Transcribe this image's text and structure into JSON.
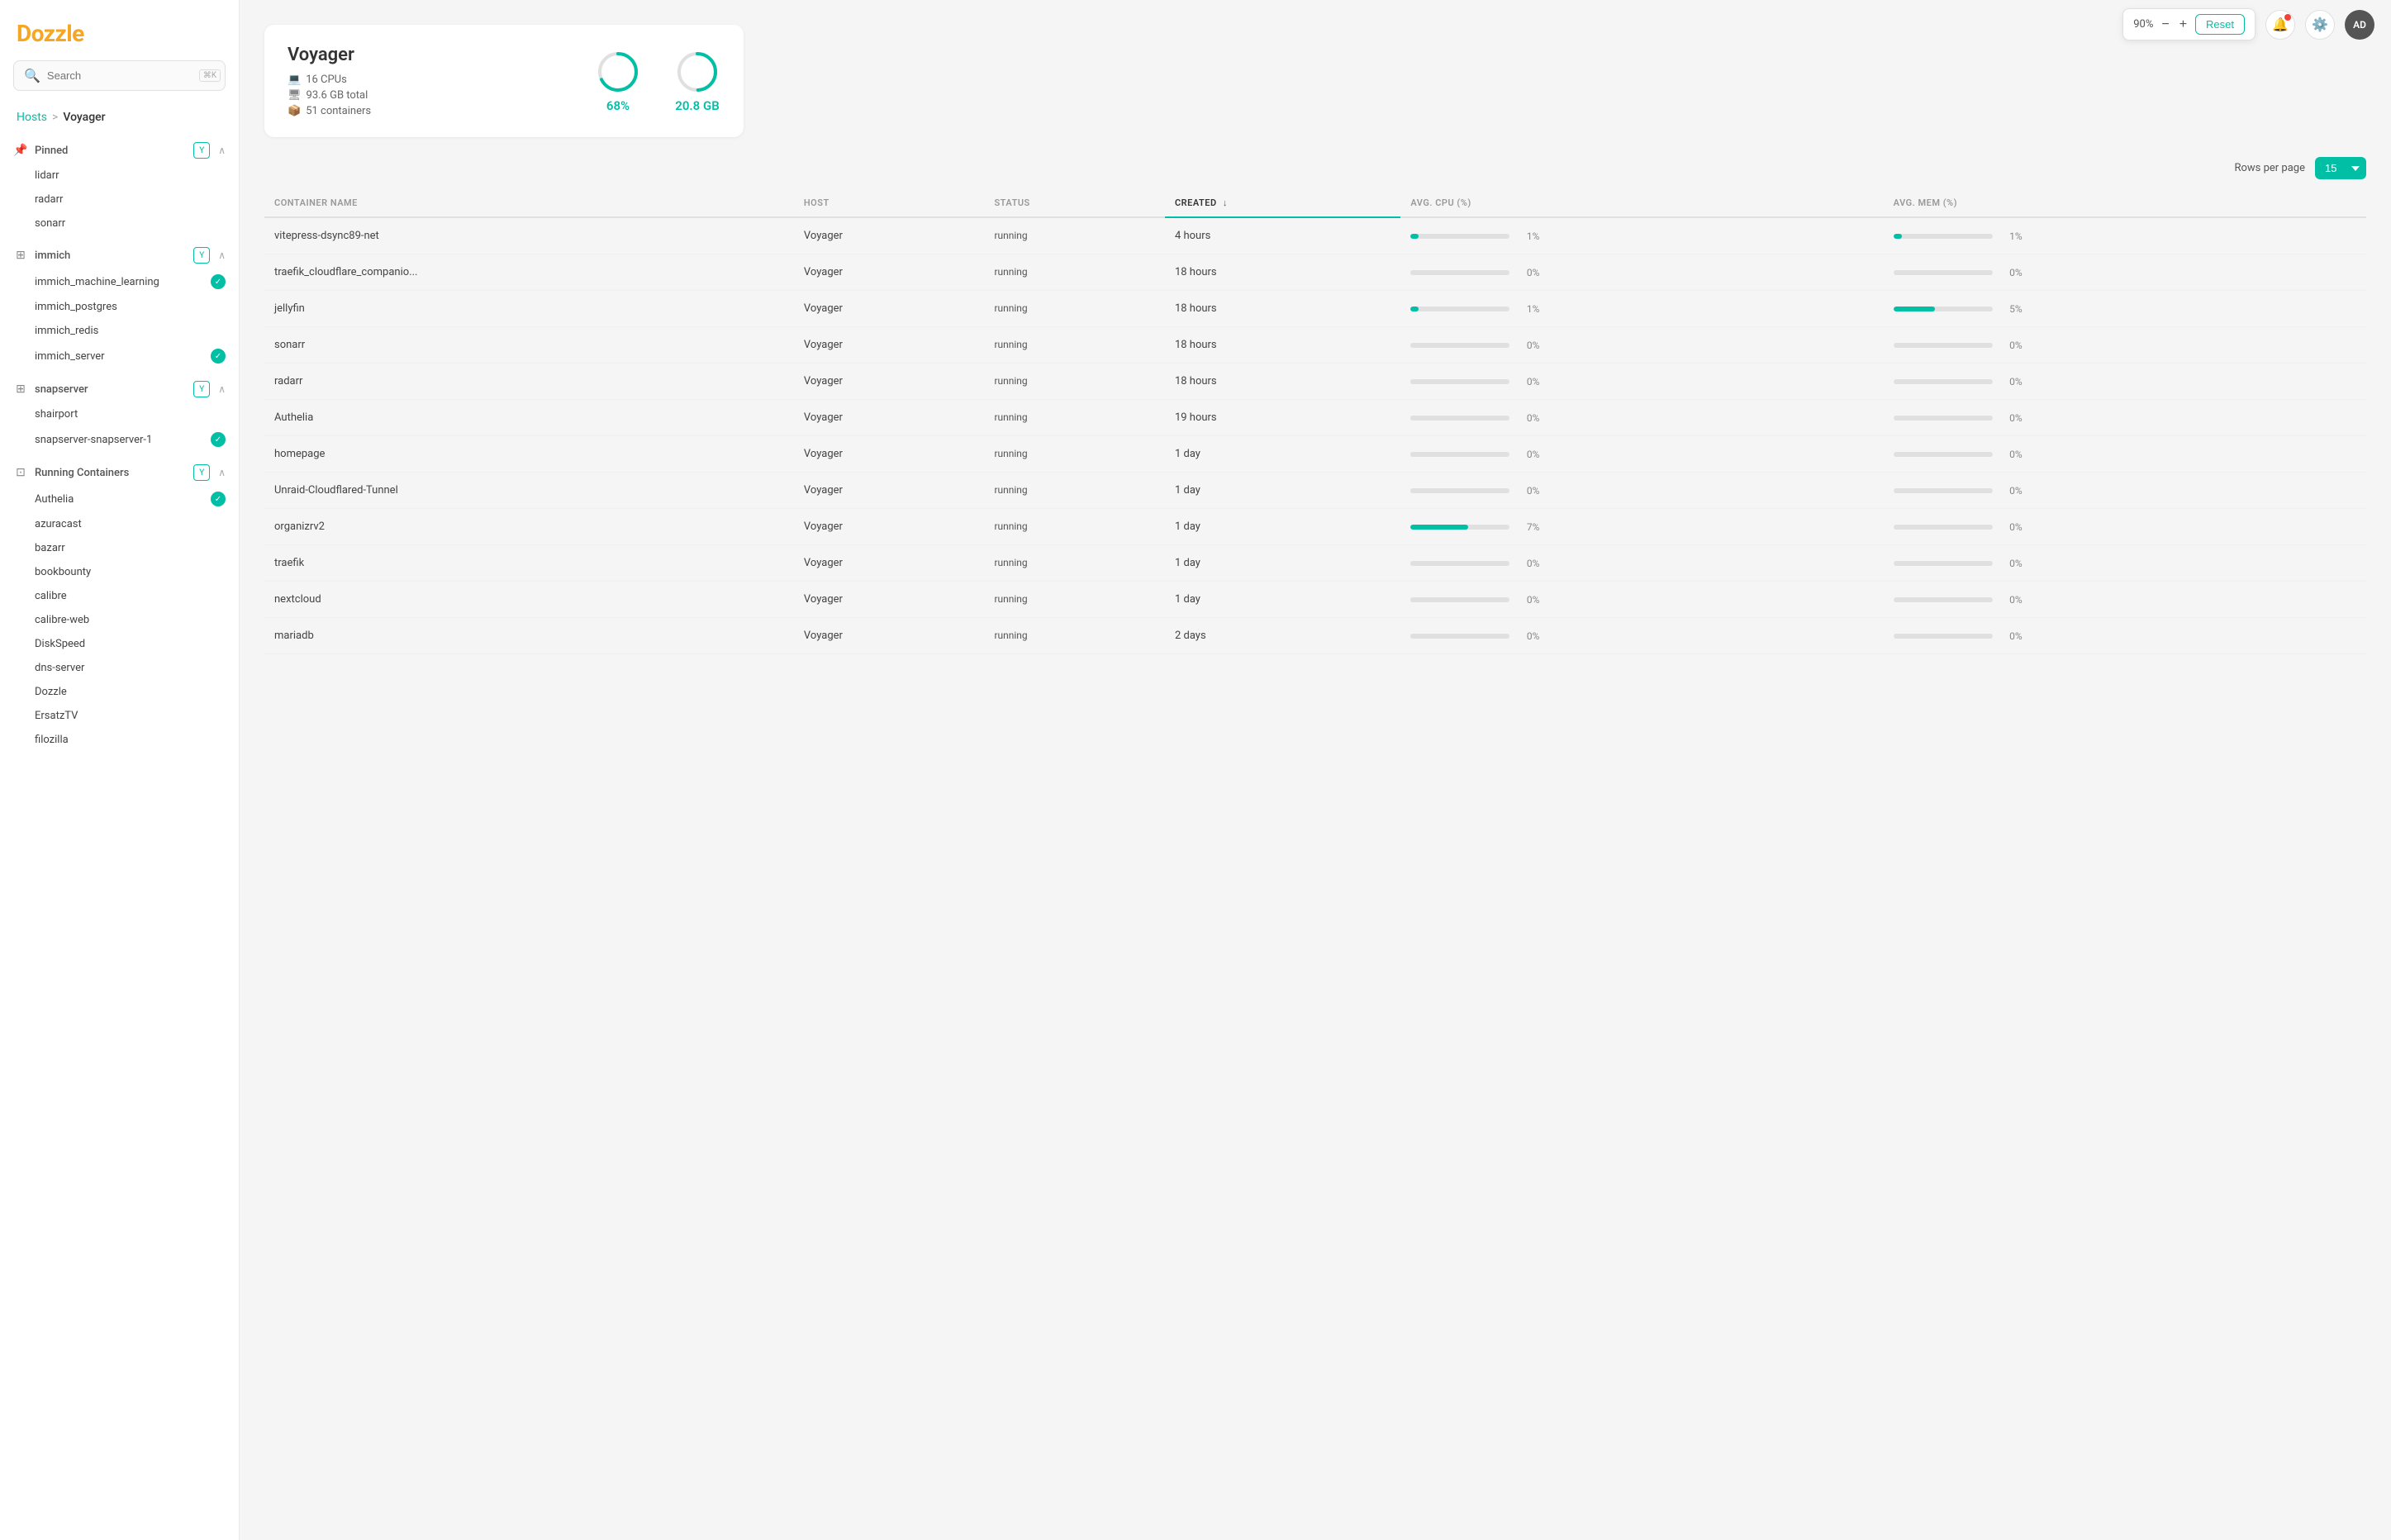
{
  "app": {
    "name": "Dozzle"
  },
  "topbar": {
    "zoom": "90%",
    "minus_label": "−",
    "plus_label": "+",
    "reset_label": "Reset",
    "avatar_label": "AD"
  },
  "sidebar": {
    "search_placeholder": "Search",
    "search_shortcut": "⌘K",
    "breadcrumb": {
      "hosts": "Hosts",
      "separator": ">",
      "current": "Voyager"
    },
    "pinned_section": {
      "label": "Pinned",
      "items": [
        {
          "label": "lidarr",
          "check": false
        },
        {
          "label": "radarr",
          "check": false
        },
        {
          "label": "sonarr",
          "check": false
        }
      ]
    },
    "immich_section": {
      "label": "immich",
      "items": [
        {
          "label": "immich_machine_learning",
          "check": true
        },
        {
          "label": "immich_postgres",
          "check": false
        },
        {
          "label": "immich_redis",
          "check": false
        },
        {
          "label": "immich_server",
          "check": true
        }
      ]
    },
    "snapserver_section": {
      "label": "snapserver",
      "items": [
        {
          "label": "shairport",
          "check": false
        },
        {
          "label": "snapserver-snapserver-1",
          "check": true
        }
      ]
    },
    "running_section": {
      "label": "Running Containers",
      "items": [
        {
          "label": "Authelia",
          "check": true
        },
        {
          "label": "azuracast",
          "check": false
        },
        {
          "label": "bazarr",
          "check": false
        },
        {
          "label": "bookbounty",
          "check": false
        },
        {
          "label": "calibre",
          "check": false
        },
        {
          "label": "calibre-web",
          "check": false
        },
        {
          "label": "DiskSpeed",
          "check": false
        },
        {
          "label": "dns-server",
          "check": false
        },
        {
          "label": "Dozzle",
          "check": false
        },
        {
          "label": "ErsatzTV",
          "check": false
        },
        {
          "label": "filozilla",
          "check": false
        }
      ]
    }
  },
  "host_card": {
    "name": "Voyager",
    "cpus": "16 CPUs",
    "memory": "93.6 GB total",
    "containers": "51 containers",
    "cpu_percent": "68%",
    "mem_value": "20.8 GB"
  },
  "table": {
    "rows_per_page_label": "Rows per page",
    "rows_per_page_value": "15",
    "columns": [
      "CONTAINER NAME",
      "HOST",
      "STATUS",
      "CREATED",
      "AVG. CPU (%)",
      "AVG. MEM (%)"
    ],
    "rows": [
      {
        "name": "vitepress-dsync89-net",
        "host": "Voyager",
        "status": "running",
        "created": "4 hours",
        "cpu": 1,
        "cpu_label": "1%",
        "mem": 1,
        "mem_label": "1%"
      },
      {
        "name": "traefik_cloudflare_companio...",
        "host": "Voyager",
        "status": "running",
        "created": "18 hours",
        "cpu": 0,
        "cpu_label": "0%",
        "mem": 0,
        "mem_label": "0%"
      },
      {
        "name": "jellyfin",
        "host": "Voyager",
        "status": "running",
        "created": "18 hours",
        "cpu": 1,
        "cpu_label": "1%",
        "mem": 5,
        "mem_label": "5%",
        "mem_highlight": true
      },
      {
        "name": "sonarr",
        "host": "Voyager",
        "status": "running",
        "created": "18 hours",
        "cpu": 0,
        "cpu_label": "0%",
        "mem": 0,
        "mem_label": "0%"
      },
      {
        "name": "radarr",
        "host": "Voyager",
        "status": "running",
        "created": "18 hours",
        "cpu": 0,
        "cpu_label": "0%",
        "mem": 0,
        "mem_label": "0%"
      },
      {
        "name": "Authelia",
        "host": "Voyager",
        "status": "running",
        "created": "19 hours",
        "cpu": 0,
        "cpu_label": "0%",
        "mem": 0,
        "mem_label": "0%"
      },
      {
        "name": "homepage",
        "host": "Voyager",
        "status": "running",
        "created": "1 day",
        "cpu": 0,
        "cpu_label": "0%",
        "mem": 0,
        "mem_label": "0%"
      },
      {
        "name": "Unraid-Cloudflared-Tunnel",
        "host": "Voyager",
        "status": "running",
        "created": "1 day",
        "cpu": 0,
        "cpu_label": "0%",
        "mem": 0,
        "mem_label": "0%"
      },
      {
        "name": "organizrv2",
        "host": "Voyager",
        "status": "running",
        "created": "1 day",
        "cpu": 7,
        "cpu_label": "7%",
        "cpu_highlight": true,
        "mem": 0,
        "mem_label": "0%"
      },
      {
        "name": "traefik",
        "host": "Voyager",
        "status": "running",
        "created": "1 day",
        "cpu": 0,
        "cpu_label": "0%",
        "mem": 0,
        "mem_label": "0%"
      },
      {
        "name": "nextcloud",
        "host": "Voyager",
        "status": "running",
        "created": "1 day",
        "cpu": 0,
        "cpu_label": "0%",
        "mem": 0,
        "mem_label": "0%"
      },
      {
        "name": "mariadb",
        "host": "Voyager",
        "status": "running",
        "created": "2 days",
        "cpu": 0,
        "cpu_label": "0%",
        "mem": 0,
        "mem_label": "0%"
      }
    ]
  },
  "colors": {
    "brand": "#f5a623",
    "accent": "#00bfa5",
    "danger": "#f44336"
  }
}
